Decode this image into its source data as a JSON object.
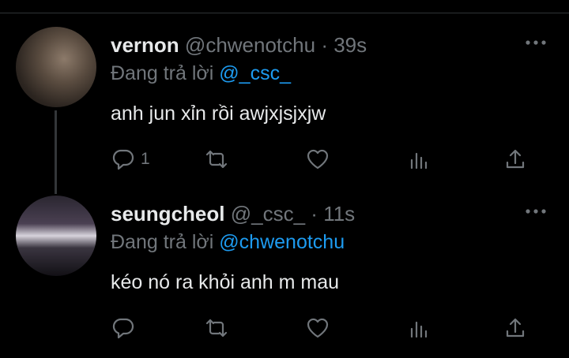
{
  "tweets": [
    {
      "display_name": "vernon",
      "handle": "@chwenotchu",
      "separator": "·",
      "time": "39s",
      "reply_prefix": "Đang trả lời",
      "reply_to": "@_csc_",
      "text": "anh jun xỉn rồi awjxjsjxjw",
      "reply_count": "1"
    },
    {
      "display_name": "seungcheol",
      "handle": "@_csc_",
      "separator": "·",
      "time": "11s",
      "reply_prefix": "Đang trả lời",
      "reply_to": "@chwenotchu",
      "text": "kéo nó ra khỏi anh m mau",
      "reply_count": ""
    }
  ],
  "icons": {
    "more": "more-icon",
    "reply": "reply-icon",
    "retweet": "retweet-icon",
    "like": "like-icon",
    "views": "views-icon",
    "share": "share-icon"
  },
  "colors": {
    "background": "#000000",
    "text": "#e7e9ea",
    "muted": "#71767b",
    "link": "#1d9bf0",
    "divider": "#2f3336"
  }
}
